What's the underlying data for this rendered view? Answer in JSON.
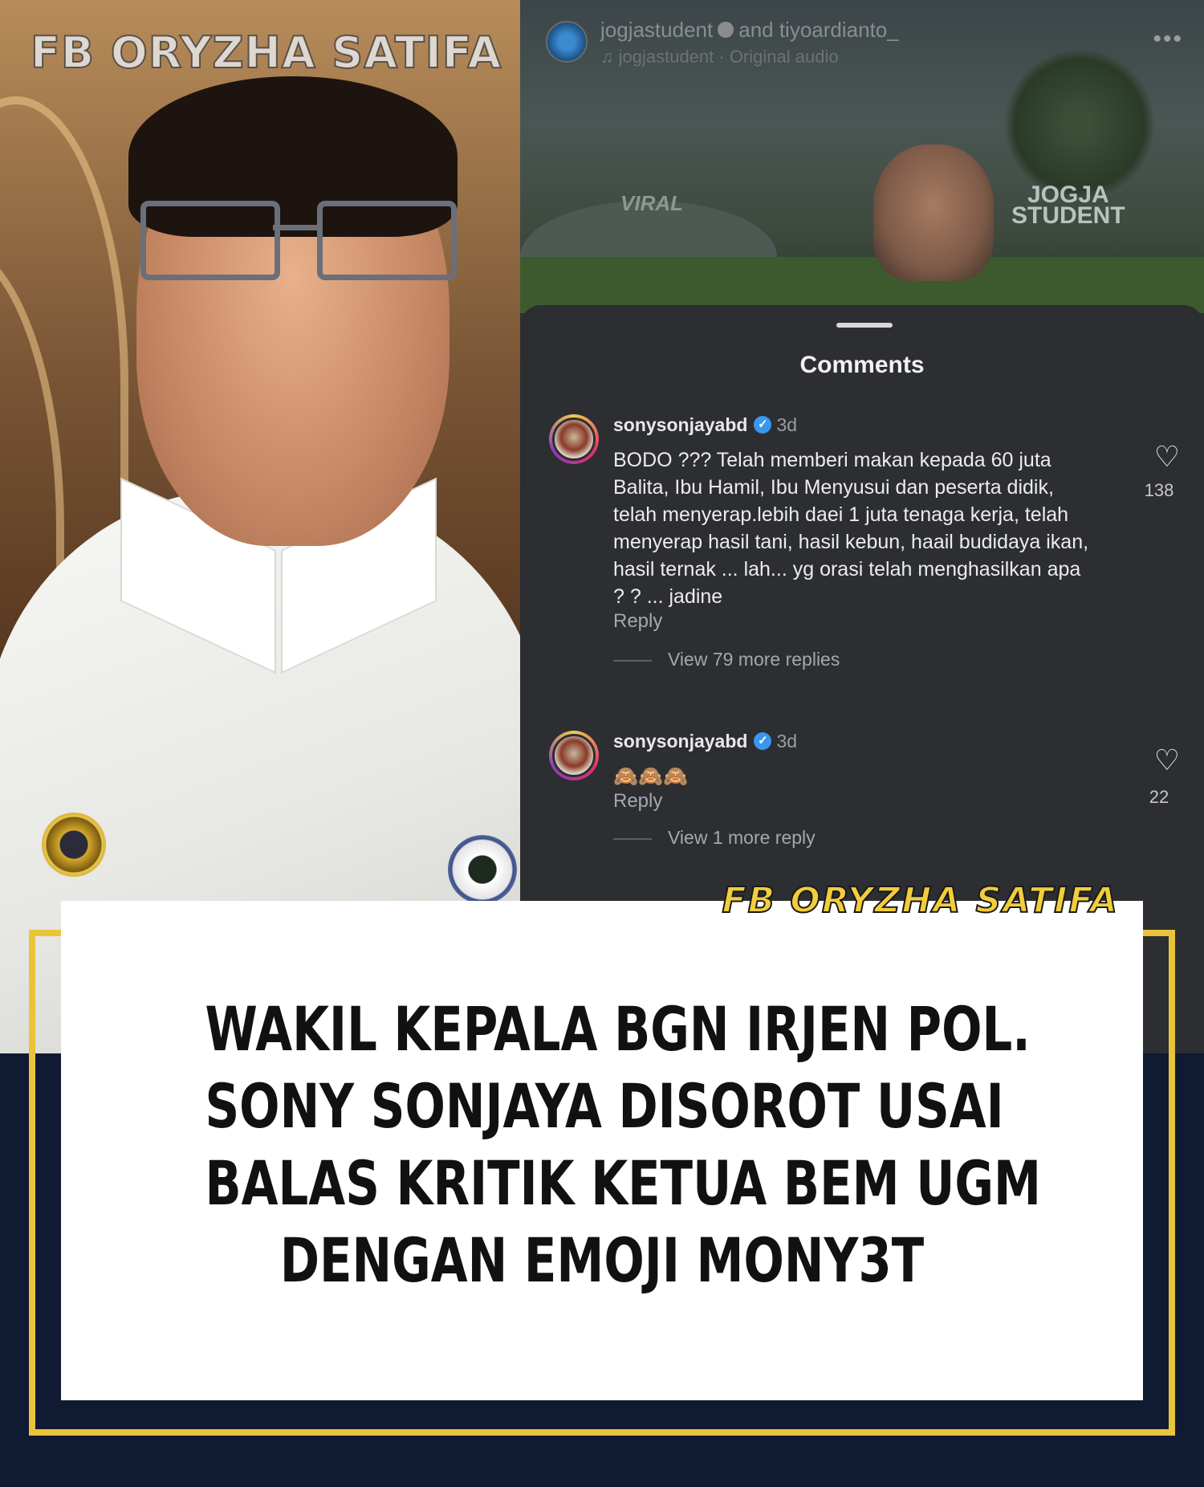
{
  "photo": {
    "watermark": "FB ORYZHA SATIFA"
  },
  "post": {
    "users": "jogjastudent",
    "users_and": "and tiyoardianto_",
    "audio": "jogjastudent · Original audio",
    "more_icon": "more-icon",
    "video_overlay_viral": "VIRAL",
    "video_logo_line1": "JOGJA",
    "video_logo_line2": "STUDENT"
  },
  "comments_sheet": {
    "title": "Comments",
    "items": [
      {
        "username": "sonysonjayabd",
        "time": "3d",
        "text": "BODO ??? Telah memberi makan kepada 60 juta Balita, Ibu Hamil, Ibu Menyusui dan peserta didik, telah menyerap.lebih daei 1 juta tenaga kerja, telah menyerap hasil tani, hasil kebun, haail budidaya ikan, hasil ternak ... lah... yg orasi telah menghasilkan apa ? ? ... jadine",
        "reply_label": "Reply",
        "view_replies": "View 79 more replies",
        "likes": "138"
      },
      {
        "username": "sonysonjayabd",
        "time": "3d",
        "text": "🙈🙈🙈",
        "reply_label": "Reply",
        "view_replies": "View 1 more reply",
        "likes": "22"
      }
    ]
  },
  "card": {
    "watermark": "FB ORYZHA SATIFA",
    "headline_lines": [
      "WAKIL KEPALA BGN IRJEN POL.",
      "SONY SONJAYA DISOROT USAI",
      "BALAS KRITIK KETUA BEM UGM",
      "DENGAN EMOJI MONY3T"
    ]
  },
  "colors": {
    "background_navy": "#101a33",
    "frame_gold": "#e9c43a",
    "sheet_dark": "#2c2e31",
    "verified_blue": "#3897f0"
  }
}
